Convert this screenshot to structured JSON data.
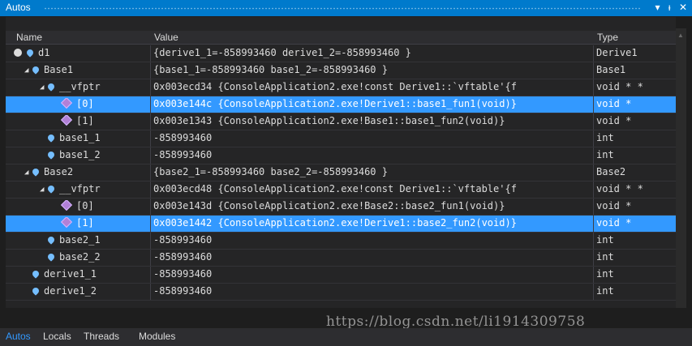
{
  "window": {
    "title": "Autos",
    "controls": [
      "▾",
      "ᵼ",
      "✕"
    ]
  },
  "columns": {
    "name": "Name",
    "value": "Value",
    "type": "Type"
  },
  "rows": [
    {
      "name": "d1",
      "value": "{derive1_1=-858993460 derive1_2=-858993460 }",
      "type": "Derive1",
      "level": 0,
      "icon": "root-icon"
    },
    {
      "name": "Base1",
      "value": "{base1_1=-858993460 base1_2=-858993460 }",
      "type": "Base1",
      "level": 1,
      "icon": "field-icon",
      "arrow": "◢"
    },
    {
      "name": "__vfptr",
      "value": "0x003ecd34 {ConsoleApplication2.exe!const Derive1::`vftable'{f",
      "type": "void * *",
      "level": 2,
      "icon": "field-icon",
      "arrow": "◢"
    },
    {
      "name": "[0]",
      "value": "0x003e144c {ConsoleApplication2.exe!Derive1::base1_fun1(void)}",
      "type": "void *",
      "level": 3,
      "icon": "vptr-icon",
      "selected": true
    },
    {
      "name": "[1]",
      "value": "0x003e1343 {ConsoleApplication2.exe!Base1::base1_fun2(void)}",
      "type": "void *",
      "level": 3,
      "icon": "vptr-icon"
    },
    {
      "name": "base1_1",
      "value": "-858993460",
      "type": "int",
      "level": 2,
      "icon": "field-icon"
    },
    {
      "name": "base1_2",
      "value": "-858993460",
      "type": "int",
      "level": 2,
      "icon": "field-icon"
    },
    {
      "name": "Base2",
      "value": "{base2_1=-858993460 base2_2=-858993460 }",
      "type": "Base2",
      "level": 1,
      "icon": "field-icon",
      "arrow": "◢"
    },
    {
      "name": "__vfptr",
      "value": "0x003ecd48 {ConsoleApplication2.exe!const Derive1::`vftable'{f",
      "type": "void * *",
      "level": 2,
      "icon": "field-icon",
      "arrow": "◢"
    },
    {
      "name": "[0]",
      "value": "0x003e143d {ConsoleApplication2.exe!Base2::base2_fun1(void)}",
      "type": "void *",
      "level": 3,
      "icon": "vptr-icon"
    },
    {
      "name": "[1]",
      "value": "0x003e1442 {ConsoleApplication2.exe!Derive1::base2_fun2(void)}",
      "type": "void *",
      "level": 3,
      "icon": "vptr-icon",
      "selected": true
    },
    {
      "name": "base2_1",
      "value": "-858993460",
      "type": "int",
      "level": 2,
      "icon": "field-icon"
    },
    {
      "name": "base2_2",
      "value": "-858993460",
      "type": "int",
      "level": 2,
      "icon": "field-icon"
    },
    {
      "name": "derive1_1",
      "value": "-858993460",
      "type": "int",
      "level": 1,
      "icon": "field-icon"
    },
    {
      "name": "derive1_2",
      "value": "-858993460",
      "type": "int",
      "level": 1,
      "icon": "field-icon"
    }
  ],
  "bottom_tabs": [
    {
      "label": "Autos",
      "active": true
    },
    {
      "label": "Locals"
    },
    {
      "label": "Threads"
    },
    {
      "label": "Modules"
    }
  ],
  "watermark": "https://blog.csdn.net/li1914309758",
  "colors": {
    "accent": "#007acc",
    "selection": "#3399ff",
    "background": "#1e1e1e"
  }
}
